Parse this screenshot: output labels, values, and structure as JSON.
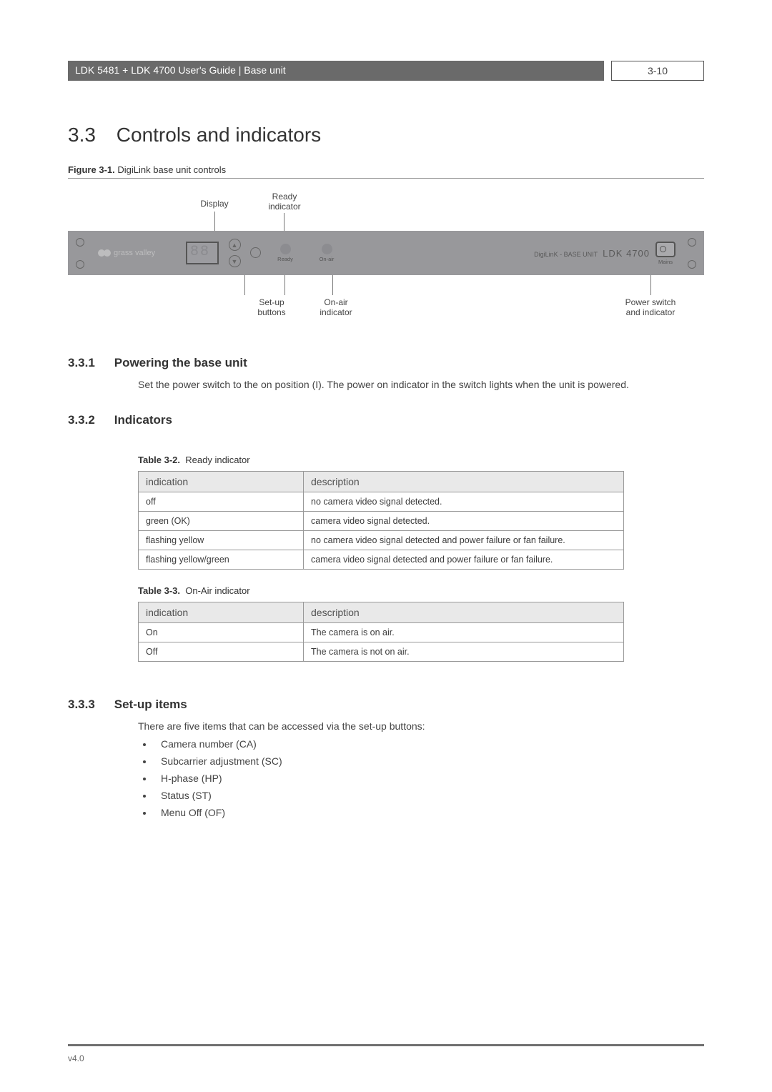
{
  "header": {
    "left": "LDK 5481 + LDK 4700 User's Guide | Base unit",
    "right": "3-10"
  },
  "section": {
    "number": "3.3",
    "title": "Controls and indicators"
  },
  "figure": {
    "label": "Figure 3-1.",
    "title": "DigiLink base unit controls",
    "callouts": {
      "display": "Display",
      "ready_indicator": "Ready\nindicator",
      "setup_buttons": "Set-up\nbuttons",
      "onair_indicator": "On-air\nindicator",
      "power": "Power switch\nand indicator"
    },
    "panel": {
      "logo": "grass valley",
      "ready": "Ready",
      "onair": "On-air",
      "model_small": "DigiLinK - BASE UNIT",
      "model_big": "LDK 4700",
      "mains": "Mains"
    }
  },
  "s331": {
    "num": "3.3.1",
    "title": "Powering the base unit",
    "body": "Set the power switch to the on position (I). The power on indicator in the switch lights when the unit is powered."
  },
  "s332": {
    "num": "3.3.2",
    "title": "Indicators"
  },
  "table32": {
    "caption_label": "Table 3-2.",
    "caption_title": "Ready indicator",
    "headers": {
      "c1": "indication",
      "c2": "description"
    },
    "rows": [
      {
        "c1": "off",
        "c2": "no camera video signal detected."
      },
      {
        "c1": "green (OK)",
        "c2": "camera video signal detected."
      },
      {
        "c1": "flashing yellow",
        "c2": "no camera video signal detected and power failure or fan failure."
      },
      {
        "c1": "flashing yellow/green",
        "c2": "camera video signal detected and power failure or fan failure."
      }
    ]
  },
  "table33": {
    "caption_label": "Table 3-3.",
    "caption_title": "On-Air indicator",
    "headers": {
      "c1": "indication",
      "c2": "description"
    },
    "rows": [
      {
        "c1": "On",
        "c2": "The camera is on air."
      },
      {
        "c1": "Off",
        "c2": "The camera is not on air."
      }
    ]
  },
  "s333": {
    "num": "3.3.3",
    "title": "Set-up items",
    "intro": "There are five items that can be accessed via the set-up buttons:",
    "items": [
      "Camera number (CA)",
      "Subcarrier adjustment (SC)",
      "H-phase (HP)",
      "Status (ST)",
      "Menu Off (OF)"
    ]
  },
  "footer": {
    "version": "v4.0"
  }
}
